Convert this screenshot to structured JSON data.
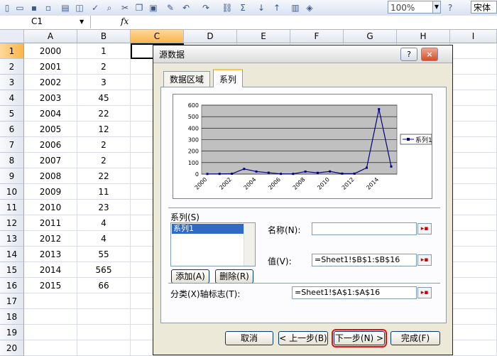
{
  "toolbar": {
    "zoom": "100%",
    "font": "宋体"
  },
  "formula_bar": {
    "name_box": "C1",
    "fx": "fx"
  },
  "columns": [
    "A",
    "B",
    "C",
    "D",
    "E",
    "F",
    "G",
    "H",
    "I"
  ],
  "rows": [
    "1",
    "2",
    "3",
    "4",
    "5",
    "6",
    "7",
    "8",
    "9",
    "10",
    "11",
    "12",
    "13",
    "14",
    "15",
    "16",
    "17",
    "18",
    "19",
    "20"
  ],
  "col_a": [
    "2000",
    "2001",
    "2002",
    "2003",
    "2004",
    "2005",
    "2006",
    "2007",
    "2008",
    "2009",
    "2010",
    "2011",
    "2012",
    "2013",
    "2014",
    "2015"
  ],
  "col_b": [
    "1",
    "2",
    "3",
    "45",
    "22",
    "12",
    "2",
    "2",
    "22",
    "11",
    "23",
    "4",
    "4",
    "55",
    "565",
    "66"
  ],
  "dialog": {
    "title": "源数据",
    "help": "?",
    "close": "×",
    "tabs": [
      "数据区域",
      "系列"
    ],
    "series_label": "系列(S)",
    "series_items": [
      "系列1"
    ],
    "add_button": "添加(A)",
    "remove_button": "删除(R)",
    "name_label": "名称(N):",
    "name_value": "",
    "values_label": "值(V):",
    "values_value": "=Sheet1!$B$1:$B$16",
    "category_label": "分类(X)轴标志(T):",
    "category_value": "=Sheet1!$A$1:$A$16",
    "cancel_button": "取消",
    "back_button": "< 上一步(B)",
    "next_button": "下一步(N) >",
    "finish_button": "完成(F)"
  },
  "chart_data": {
    "type": "line",
    "x": [
      2000,
      2001,
      2002,
      2003,
      2004,
      2005,
      2006,
      2007,
      2008,
      2009,
      2010,
      2011,
      2012,
      2013,
      2014,
      2015
    ],
    "series": [
      {
        "name": "系列1",
        "values": [
          1,
          2,
          3,
          45,
          22,
          12,
          2,
          2,
          22,
          11,
          23,
          4,
          4,
          55,
          565,
          66
        ]
      }
    ],
    "xtick_labels": [
      "2000",
      "2002",
      "2004",
      "2006",
      "2008",
      "2010",
      "2012",
      "2014"
    ],
    "ytick_labels": [
      "0",
      "100",
      "200",
      "300",
      "400",
      "500",
      "600"
    ],
    "ylim": [
      0,
      600
    ],
    "grid": true,
    "legend": "right",
    "plot_background": "#c0c0c0",
    "line_color": "#000080"
  }
}
